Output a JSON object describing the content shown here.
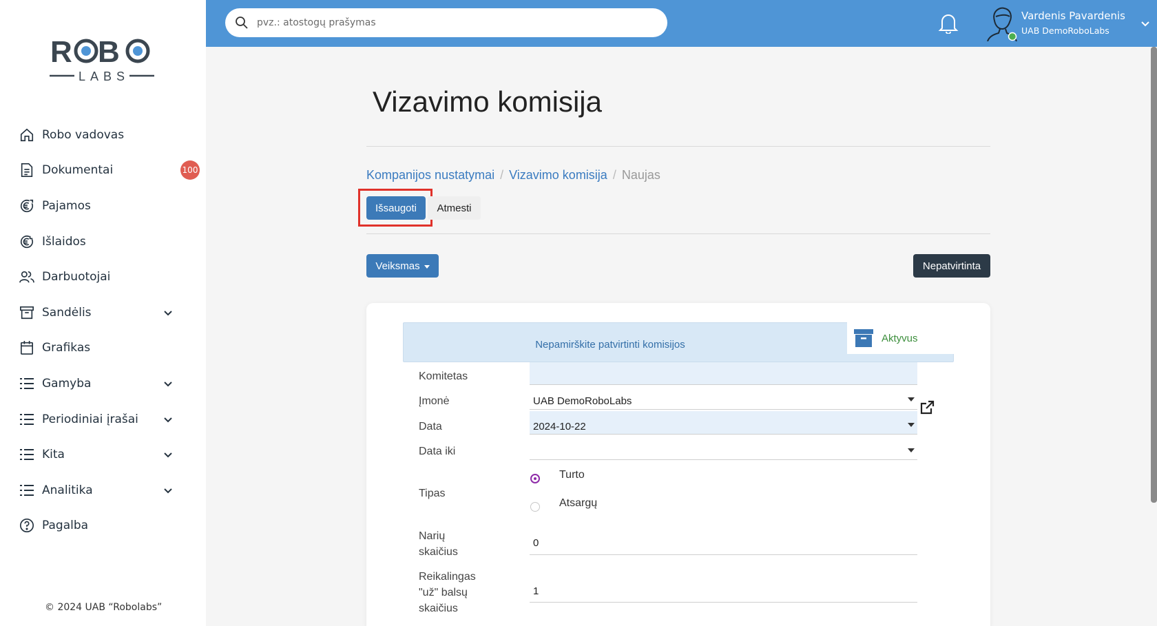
{
  "brand": {
    "logo_text_top": "ROBO",
    "logo_text_bottom": "LABS"
  },
  "sidebar": {
    "items": [
      {
        "label": "Robo vadovas",
        "icon": "home-icon"
      },
      {
        "label": "Dokumentai",
        "icon": "document-icon",
        "badge": "100"
      },
      {
        "label": "Pajamos",
        "icon": "euro-in-icon"
      },
      {
        "label": "Išlaidos",
        "icon": "euro-out-icon"
      },
      {
        "label": "Darbuotojai",
        "icon": "users-icon"
      },
      {
        "label": "Sandėlis",
        "icon": "archive-icon",
        "expandable": true
      },
      {
        "label": "Grafikas",
        "icon": "calendar-icon"
      },
      {
        "label": "Gamyba",
        "icon": "list-icon",
        "expandable": true
      },
      {
        "label": "Periodiniai įrašai",
        "icon": "list-icon",
        "expandable": true
      },
      {
        "label": "Kita",
        "icon": "list-icon",
        "expandable": true
      },
      {
        "label": "Analitika",
        "icon": "list-icon",
        "expandable": true
      },
      {
        "label": "Pagalba",
        "icon": "help-icon"
      }
    ],
    "copyright": "© 2024 UAB “Robolabs”"
  },
  "topbar": {
    "search_placeholder": "pvz.: atostogų prašymas",
    "user_name": "Vardenis Pavardenis",
    "user_company": "UAB DemoRoboLabs",
    "online_color": "#4caf50"
  },
  "page": {
    "title": "Vizavimo komisija",
    "breadcrumb": {
      "item1": "Kompanijos nustatymai",
      "item2": "Vizavimo komisija",
      "current": "Naujas",
      "separator": "/"
    },
    "save_label": "Išsaugoti",
    "discard_label": "Atmesti",
    "action_label": "Veiksmas",
    "status_label": "Nepatvirtinta"
  },
  "form": {
    "alert_text": "Nepamirškite patvirtinti komisijos",
    "ribbon_label": "Aktyvus",
    "committee_label": "Komitetas",
    "committee_value": "",
    "company_label": "Įmonė",
    "company_value": "UAB DemoRoboLabs",
    "date_label": "Data",
    "date_value": "2024-10-22",
    "date_to_label": "Data iki",
    "date_to_value": "",
    "type_label": "Tipas",
    "type_options": [
      "Turto",
      "Atsargų"
    ],
    "type_selected": "Turto",
    "members_label_1": "Narių",
    "members_label_2": "skaičius",
    "members_value": "0",
    "votes_label_1": "Reikalingas",
    "votes_label_2": "\"už\" balsų",
    "votes_label_3": "skaičius",
    "votes_value": "1"
  },
  "colors": {
    "topbar": "#4f95d6",
    "primary_button": "#3c7ab8",
    "highlight_outline": "#e0322b",
    "status_dark": "#2c3a47",
    "badge": "#e05d52",
    "radio_selected": "#8e2ba8"
  }
}
